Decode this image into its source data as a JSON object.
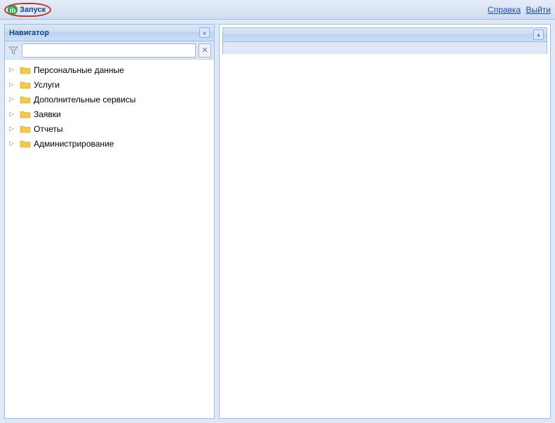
{
  "toolbar": {
    "start_label": "Запуск",
    "help_label": "Справка",
    "logout_label": "Выйти"
  },
  "navigator": {
    "title": "Навигатор",
    "filter_placeholder": "",
    "items": [
      {
        "label": "Персональные данные"
      },
      {
        "label": "Услуги"
      },
      {
        "label": "Дополнительные сервисы"
      },
      {
        "label": "Заявки"
      },
      {
        "label": "Отчеты"
      },
      {
        "label": "Администрирование"
      }
    ]
  }
}
